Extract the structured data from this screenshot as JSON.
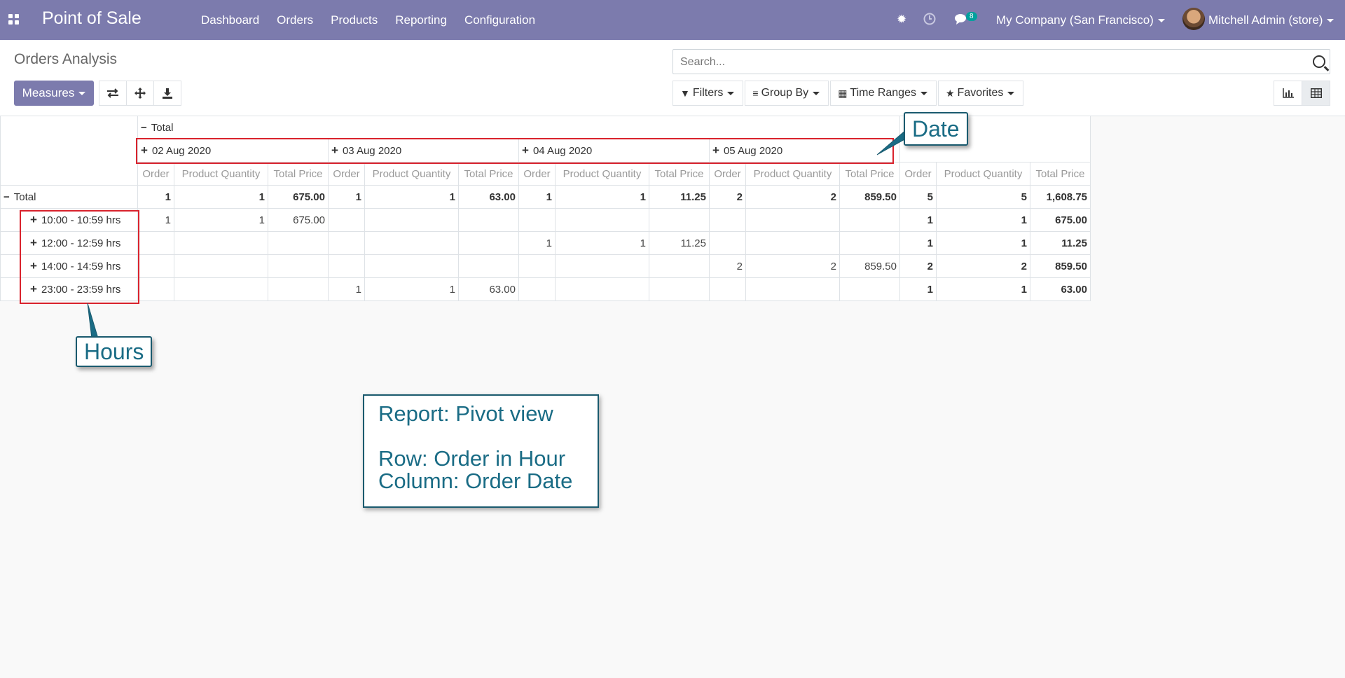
{
  "navbar": {
    "brand": "Point of Sale",
    "menu": [
      "Dashboard",
      "Orders",
      "Products",
      "Reporting",
      "Configuration"
    ],
    "message_count": "8",
    "company": "My Company (San Francisco)",
    "user": "Mitchell Admin (store)"
  },
  "control": {
    "title": "Orders Analysis",
    "measures_label": "Measures",
    "search_placeholder": "Search...",
    "filters_label": "Filters",
    "groupby_label": "Group By",
    "timeranges_label": "Time Ranges",
    "favorites_label": "Favorites"
  },
  "pivot": {
    "total_label": "Total",
    "dates": [
      "02 Aug 2020",
      "03 Aug 2020",
      "04 Aug 2020",
      "05 Aug 2020"
    ],
    "measures": [
      "Order",
      "Product Quantity",
      "Total Price"
    ],
    "total_row": [
      "1",
      "1",
      "675.00",
      "1",
      "1",
      "63.00",
      "1",
      "1",
      "11.25",
      "2",
      "2",
      "859.50",
      "5",
      "5",
      "1,608.75"
    ],
    "rows": [
      {
        "label": "10:00 - 10:59 hrs",
        "cells": [
          "1",
          "1",
          "675.00",
          "",
          "",
          "",
          "",
          "",
          "",
          "",
          "",
          "",
          "1",
          "1",
          "675.00"
        ]
      },
      {
        "label": "12:00 - 12:59 hrs",
        "cells": [
          "",
          "",
          "",
          "",
          "",
          "",
          "1",
          "1",
          "11.25",
          "",
          "",
          "",
          "1",
          "1",
          "11.25"
        ]
      },
      {
        "label": "14:00 - 14:59 hrs",
        "cells": [
          "",
          "",
          "",
          "",
          "",
          "",
          "",
          "",
          "",
          "2",
          "2",
          "859.50",
          "2",
          "2",
          "859.50"
        ]
      },
      {
        "label": "23:00 - 23:59 hrs",
        "cells": [
          "",
          "",
          "",
          "1",
          "1",
          "63.00",
          "",
          "",
          "",
          "",
          "",
          "",
          "1",
          "1",
          "63.00"
        ]
      }
    ]
  },
  "annotations": {
    "date_callout": "Date",
    "hours_callout": "Hours",
    "info_line1": "Report: Pivot view",
    "info_line2": "Row: Order in Hour",
    "info_line3": "Column: Order Date"
  }
}
